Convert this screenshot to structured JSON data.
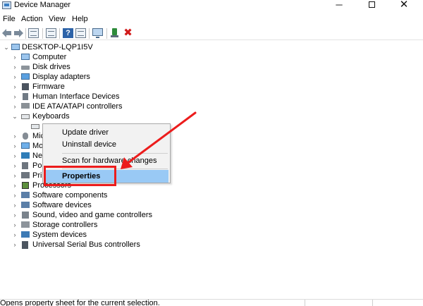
{
  "window": {
    "title": "Device Manager",
    "controls": {
      "minimize": "─",
      "close": "✕"
    }
  },
  "menubar": [
    {
      "label": "File"
    },
    {
      "label": "Action"
    },
    {
      "label": "View"
    },
    {
      "label": "Help"
    }
  ],
  "toolbar": {
    "icons": [
      "back-arrow-icon",
      "forward-arrow-icon",
      "properties-sheet-icon",
      "update-driver-sheet-icon",
      "help-icon",
      "show-hidden-icon",
      "scan-monitor-icon",
      "add-driver-icon",
      "uninstall-x-icon"
    ],
    "help_glyph": "?",
    "remove_glyph": "✖"
  },
  "tree": {
    "root": {
      "label": "DESKTOP-LQP1I5V",
      "expanded": true
    },
    "categories": [
      {
        "label": "Computer",
        "icon": "computer-icon"
      },
      {
        "label": "Disk drives",
        "icon": "disk-drive-icon"
      },
      {
        "label": "Display adapters",
        "icon": "display-adapter-icon"
      },
      {
        "label": "Firmware",
        "icon": "firmware-icon"
      },
      {
        "label": "Human Interface Devices",
        "icon": "hid-icon"
      },
      {
        "label": "IDE ATA/ATAPI controllers",
        "icon": "ide-controller-icon"
      },
      {
        "label": "Keyboards",
        "icon": "keyboard-icon",
        "expanded": true
      },
      {
        "label": "Mic",
        "icon": "mice-icon"
      },
      {
        "label": "Mo",
        "icon": "monitor-icon"
      },
      {
        "label": "Net",
        "icon": "network-adapter-icon"
      },
      {
        "label": "Por",
        "icon": "ports-icon"
      },
      {
        "label": "Prin",
        "icon": "print-queue-icon"
      },
      {
        "label": "Processors",
        "icon": "processor-icon"
      },
      {
        "label": "Software components",
        "icon": "software-component-icon"
      },
      {
        "label": "Software devices",
        "icon": "software-device-icon"
      },
      {
        "label": "Sound, video and game controllers",
        "icon": "sound-icon"
      },
      {
        "label": "Storage controllers",
        "icon": "storage-controller-icon"
      },
      {
        "label": "System devices",
        "icon": "system-device-icon"
      },
      {
        "label": "Universal Serial Bus controllers",
        "icon": "usb-icon"
      }
    ],
    "chevron_collapsed": "›",
    "chevron_expanded": "⌄"
  },
  "context_menu": {
    "items": [
      {
        "label": "Update driver"
      },
      {
        "label": "Uninstall device"
      },
      {
        "label": "Scan for hardware changes"
      },
      {
        "label": "Properties",
        "highlighted": true
      }
    ]
  },
  "annotation": {
    "color": "#ec1c1c"
  },
  "status_bar": {
    "text": "Opens property sheet for the current selection."
  },
  "colors": {
    "menu_highlight": "#99c9f5",
    "annotation_red": "#ec1c1c",
    "tree_icon_blue": "#3f6d9b"
  }
}
